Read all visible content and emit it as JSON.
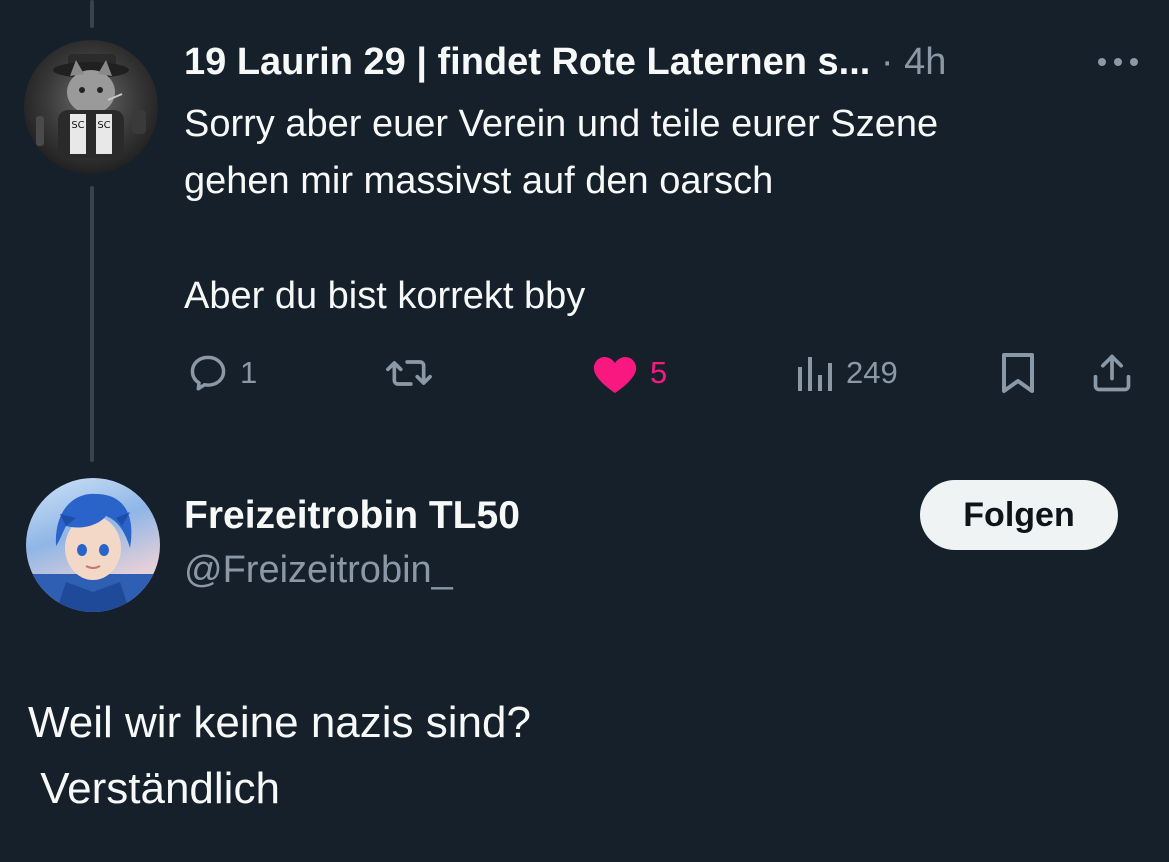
{
  "tweet": {
    "author_display": "19 Laurin 29 | findet Rote Laternen s...",
    "dot": "·",
    "time": "4h",
    "more_icon": "ellipsis-icon",
    "text_line_1": "Sorry aber euer Verein und teile eurer Szene",
    "text_line_2": "gehen mir massivst auf den oarsch",
    "text_line_3": "Aber du bist korrekt bby",
    "actions": {
      "reply_icon": "reply-icon",
      "reply_count": "1",
      "retweet_icon": "retweet-icon",
      "like_icon": "heart-icon",
      "like_count": "5",
      "like_active": true,
      "like_color": "#f91880",
      "views_icon": "views-icon",
      "views_count": "249",
      "bookmark_icon": "bookmark-icon",
      "share_icon": "share-icon"
    },
    "avatar_icon": "cat-avatar"
  },
  "reply": {
    "author_name": "Freizeitrobin TL50",
    "author_handle": "@Freizeitrobin_",
    "follow_label": "Folgen",
    "avatar_icon": "anime-avatar",
    "text_line_1": "Weil wir keine nazis sind?",
    "text_line_2": " Verständlich"
  },
  "colors": {
    "background": "#15202b",
    "text_primary": "#f7f9f9",
    "text_secondary": "#8b98a5",
    "thread_line": "#38444d",
    "like_pink": "#f91880",
    "follow_bg": "#eff3f4"
  }
}
